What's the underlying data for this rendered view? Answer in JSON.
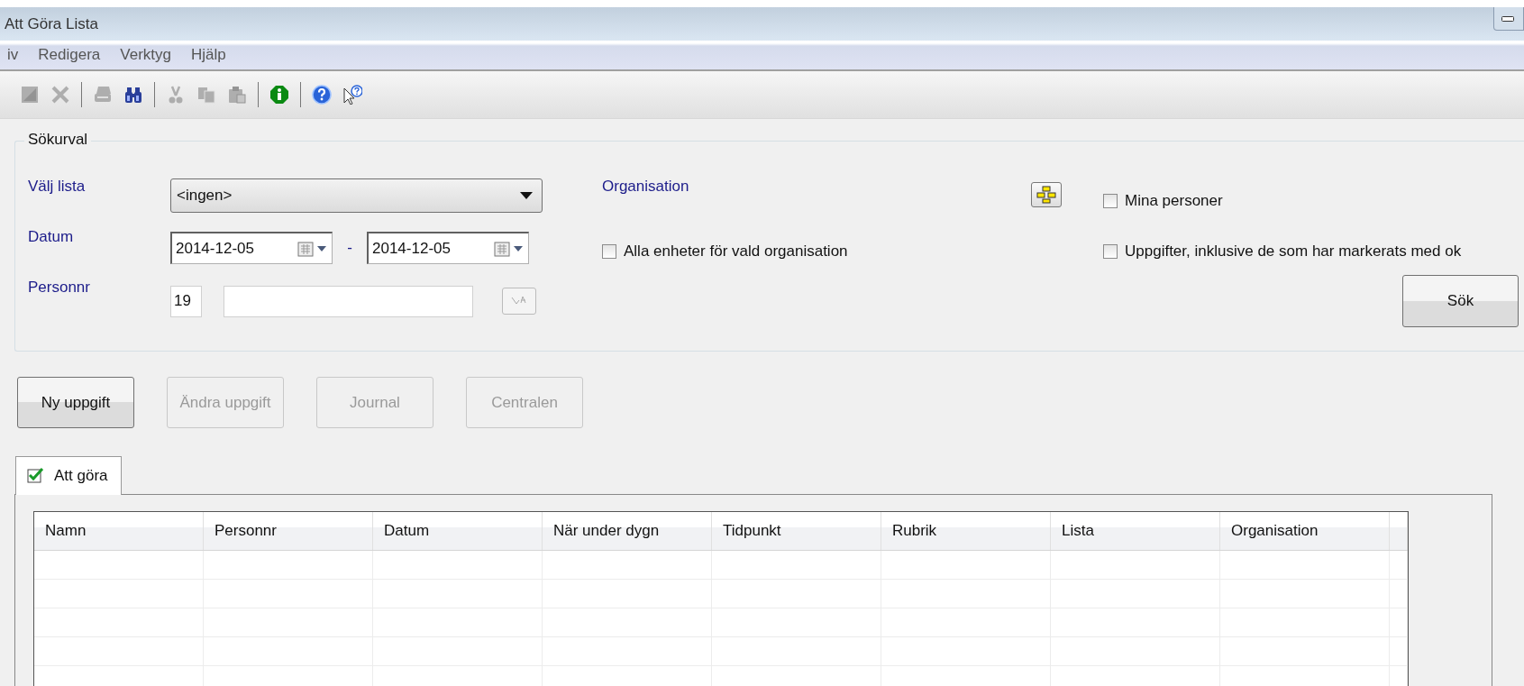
{
  "window": {
    "title": "Att Göra Lista"
  },
  "menu": [
    "iv",
    "Redigera",
    "Verktyg",
    "Hjälp"
  ],
  "toolbar": [
    {
      "kind": "save",
      "disabled": true
    },
    {
      "kind": "delete",
      "disabled": true
    },
    {
      "kind": "separator"
    },
    {
      "kind": "print",
      "disabled": true
    },
    {
      "kind": "find",
      "disabled": false
    },
    {
      "kind": "separator"
    },
    {
      "kind": "cut",
      "disabled": true
    },
    {
      "kind": "copy",
      "disabled": true
    },
    {
      "kind": "paste",
      "disabled": true
    },
    {
      "kind": "separator"
    },
    {
      "kind": "info",
      "disabled": false
    },
    {
      "kind": "separator"
    },
    {
      "kind": "help",
      "disabled": false
    },
    {
      "kind": "whatsthis",
      "disabled": false
    }
  ],
  "search": {
    "title": "Sökurval",
    "list_label": "Välj lista",
    "list_value": "<ingen>",
    "date_label": "Datum",
    "date_from": "2014-12-05",
    "date_separator": "-",
    "date_to": "2014-12-05",
    "personnr_label": "Personnr",
    "personnr_prefix": "19",
    "organisation_label": "Organisation",
    "checkboxes": [
      {
        "label": "Mina personer",
        "checked": false
      },
      {
        "label": "Alla enheter för vald organisation",
        "checked": false
      },
      {
        "label": "Uppgifter, inklusive de som har markerats med ok",
        "checked": false
      }
    ],
    "search_button": "Sök"
  },
  "actions": [
    {
      "label": "Ny uppgift",
      "disabled": false
    },
    {
      "label": "Ändra uppgift",
      "disabled": true
    },
    {
      "label": "Journal",
      "disabled": true
    },
    {
      "label": "Centralen",
      "disabled": true
    }
  ],
  "tabs": [
    {
      "label": "Att göra",
      "selected": true
    }
  ],
  "table": {
    "columns": [
      "Namn",
      "Personnr",
      "Datum",
      "När under dygn",
      "Tidpunkt",
      "Rubrik",
      "Lista",
      "Organisation"
    ]
  }
}
